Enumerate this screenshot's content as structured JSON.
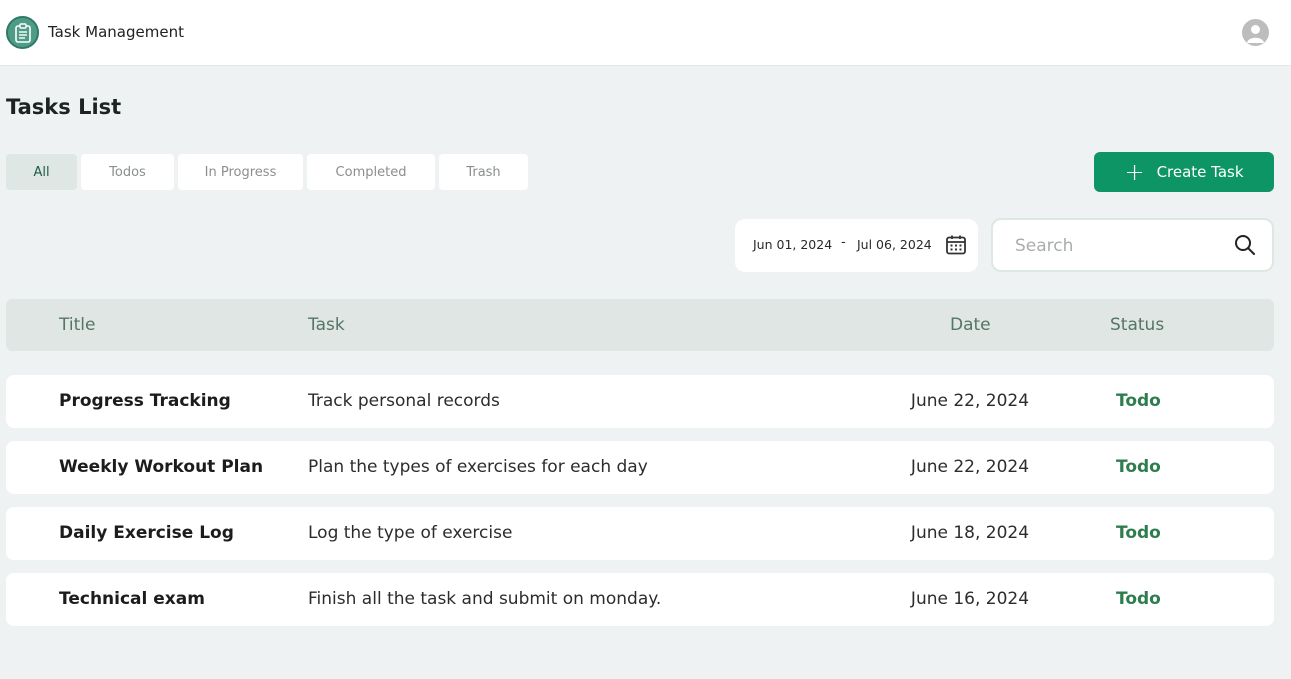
{
  "app": {
    "title": "Task Management"
  },
  "page": {
    "title": "Tasks List"
  },
  "tabs": [
    {
      "label": "All",
      "active": true
    },
    {
      "label": "Todos",
      "active": false
    },
    {
      "label": "In Progress",
      "active": false
    },
    {
      "label": "Completed",
      "active": false
    },
    {
      "label": "Trash",
      "active": false
    }
  ],
  "create_button": {
    "label": "Create Task",
    "icon": "plus-icon"
  },
  "date_range": {
    "from": "Jun 01, 2024",
    "separator": "-",
    "to": "Jul 06, 2024",
    "icon": "calendar-icon"
  },
  "search": {
    "placeholder": "Search",
    "value": "",
    "icon": "search-icon"
  },
  "table": {
    "columns": [
      "Title",
      "Task",
      "Date",
      "Status"
    ],
    "rows": [
      {
        "title": "Progress Tracking",
        "task": "Track personal records",
        "date": "June 22, 2024",
        "status": "Todo"
      },
      {
        "title": "Weekly Workout Plan",
        "task": "Plan the types of exercises for each day",
        "date": "June 22, 2024",
        "status": "Todo"
      },
      {
        "title": "Daily Exercise Log",
        "task": "Log the type of exercise",
        "date": "June 18, 2024",
        "status": "Todo"
      },
      {
        "title": "Technical exam",
        "task": "Finish all the task and submit on monday.",
        "date": "June 16, 2024",
        "status": "Todo"
      }
    ]
  },
  "colors": {
    "accent": "#0e9566",
    "status_todo": "#2e7d4f",
    "background": "#eff2f2"
  }
}
